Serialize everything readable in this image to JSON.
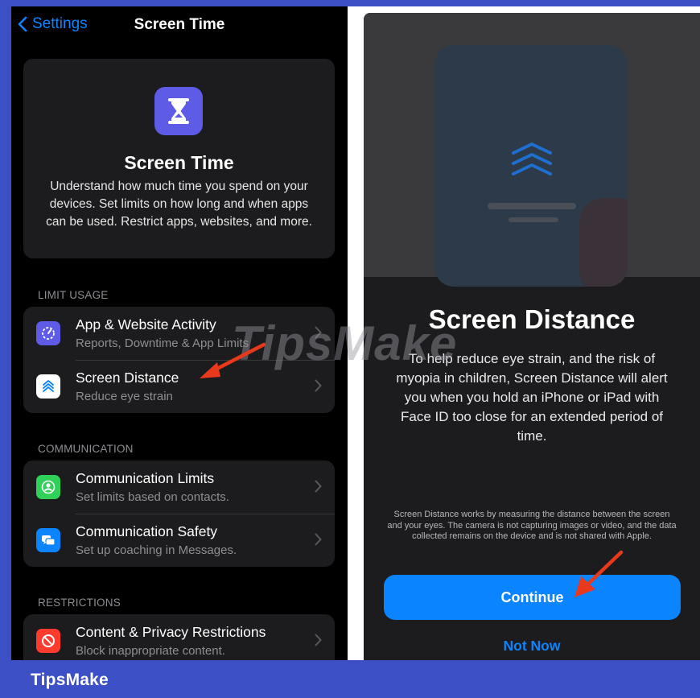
{
  "left_screen": {
    "back_label": "Settings",
    "title": "Screen Time",
    "hero": {
      "title": "Screen Time",
      "description": "Understand how much time you spend on your devices. Set limits on how long and when apps can be used. Restrict apps, websites, and more."
    },
    "sections": [
      {
        "header": "LIMIT USAGE",
        "items": [
          {
            "title": "App & Website Activity",
            "subtitle": "Reports, Downtime & App Limits",
            "icon": "activity-icon",
            "icon_color": "#5e5ce6"
          },
          {
            "title": "Screen Distance",
            "subtitle": "Reduce eye strain",
            "icon": "screen-distance-icon",
            "icon_color": "#ffffff"
          }
        ]
      },
      {
        "header": "COMMUNICATION",
        "items": [
          {
            "title": "Communication Limits",
            "subtitle": "Set limits based on contacts.",
            "icon": "contact-icon",
            "icon_color": "#30d158"
          },
          {
            "title": "Communication Safety",
            "subtitle": "Set up coaching in Messages.",
            "icon": "chat-bubbles-icon",
            "icon_color": "#0a84ff"
          }
        ]
      },
      {
        "header": "RESTRICTIONS",
        "items": [
          {
            "title": "Content & Privacy Restrictions",
            "subtitle": "Block inappropriate content.",
            "icon": "block-icon",
            "icon_color": "#ff3b30"
          }
        ]
      }
    ]
  },
  "right_screen": {
    "title": "Screen Distance",
    "description": "To help reduce eye strain, and the risk of myopia in children, Screen Distance will alert you when you hold an iPhone or iPad with Face ID too close for an extended period of time.",
    "fine_print": "Screen Distance works by measuring the distance between the screen and your eyes. The camera is not capturing images or video, and the data collected remains on the device and is not shared with Apple.",
    "continue_label": "Continue",
    "not_now_label": "Not Now"
  },
  "watermark": "TipsMake",
  "brand": "TipsMake",
  "colors": {
    "frame": "#3d4fc4",
    "accent": "#0a84ff",
    "arrow": "#e8391c"
  }
}
